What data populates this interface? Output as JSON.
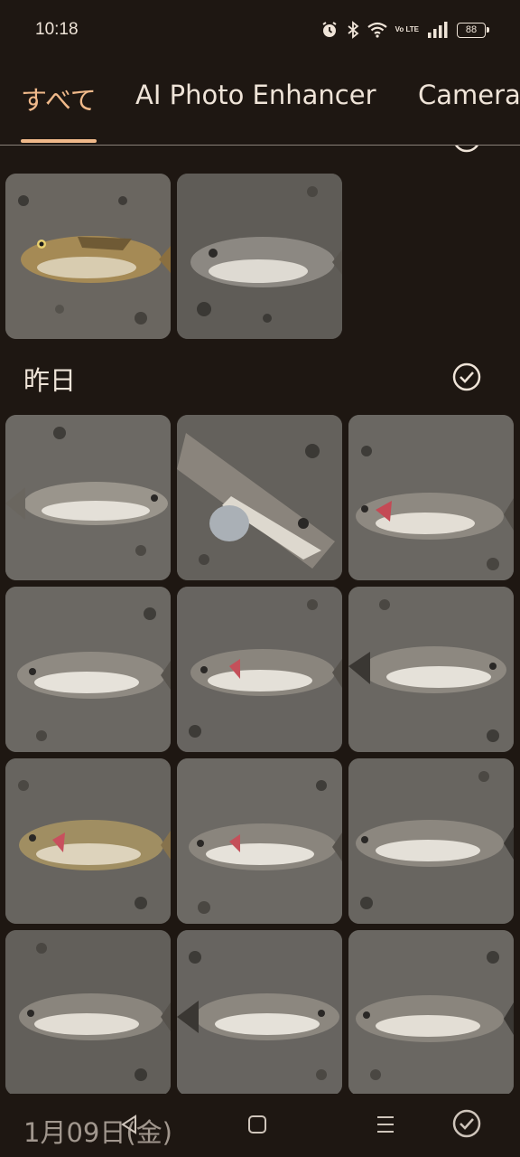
{
  "status_bar": {
    "time": "10:18",
    "network": "Vo LTE",
    "battery": "88"
  },
  "tabs": [
    {
      "label": "すべて",
      "active": true
    },
    {
      "label": "AI Photo Enhancer",
      "active": false
    },
    {
      "label": "Camera",
      "active": false
    }
  ],
  "colors": {
    "accent": "#f0b98a",
    "background": "#1e1712",
    "text": "#efe4d8"
  },
  "sections": [
    {
      "label": "",
      "photos": 2
    },
    {
      "label": "昨日",
      "photos": 12
    }
  ],
  "bottom_bar": {
    "date_label": "1月09日(金)",
    "nav": [
      "back-icon",
      "home-icon",
      "recents-icon"
    ],
    "select_all_icon": "check-circle-icon"
  }
}
